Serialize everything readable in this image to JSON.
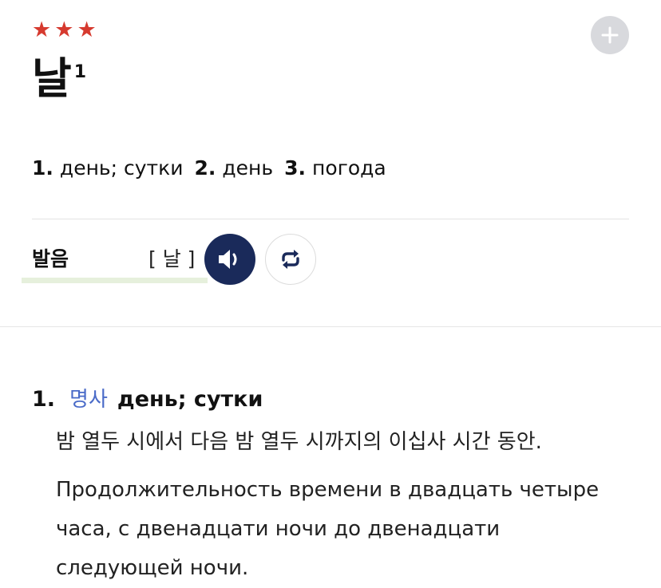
{
  "entry": {
    "stars": [
      "★",
      "★",
      "★"
    ],
    "headword": "날",
    "homonym_number": "1",
    "add_icon": "plus-icon"
  },
  "summary": [
    {
      "num": "1.",
      "text": "день; сутки"
    },
    {
      "num": "2.",
      "text": "день"
    },
    {
      "num": "3.",
      "text": "погода"
    }
  ],
  "pronunciation": {
    "label": "발음",
    "value": "[ 날 ]",
    "play_icon": "speaker-icon",
    "repeat_icon": "repeat-icon"
  },
  "senses": [
    {
      "num": "1.",
      "pos": "명사",
      "translation": "день; сутки",
      "definition_ko": "밤 열두 시에서 다음 밤 열두 시까지의 이십사 시간 동안.",
      "definition_ru": "Продолжительность времени в двадцать четыре часа, с двенадцати ночи до двенадцати следующей ночи."
    }
  ],
  "colors": {
    "star": "#d63a2f",
    "pos_link": "#4a6bc8",
    "sound_button": "#1a2a5a",
    "repeat_icon": "#1a2a5a",
    "underline": "#e6f0dc"
  }
}
